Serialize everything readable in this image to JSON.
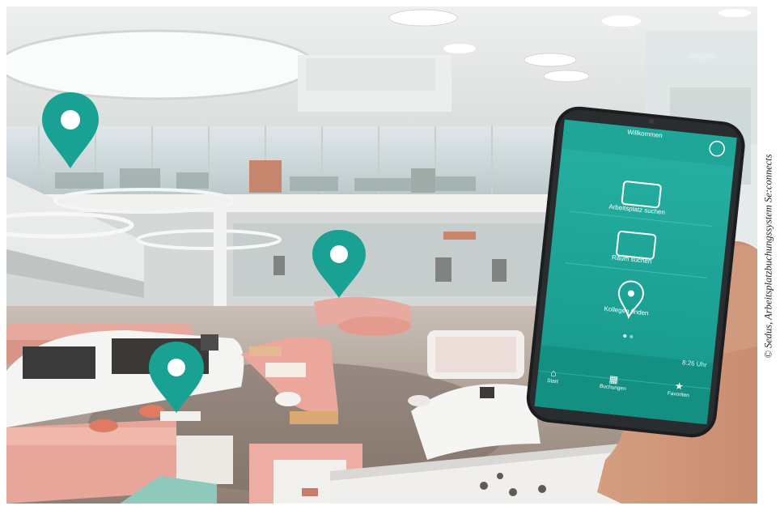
{
  "photo": {
    "subject": "open-plan office interior with smartphone app",
    "colors": {
      "teal": "#1aa396",
      "pink": "#e8a69b",
      "white": "#f4f4f2",
      "floor": "#8a7d74"
    },
    "icons": [
      "location-pin-icon",
      "location-pin-icon",
      "location-pin-icon"
    ]
  },
  "credit": "© Sedus, Arbeitsplatzbuchungssystem Se:connects",
  "phone": {
    "screen_title": "Willkommen",
    "items": [
      "Arbeitsplatz suchen",
      "Raum suchen",
      "Kollegen finden"
    ],
    "time": "8:26 Uhr",
    "nav": [
      "Start",
      "Buchungen",
      "Favoriten"
    ]
  }
}
